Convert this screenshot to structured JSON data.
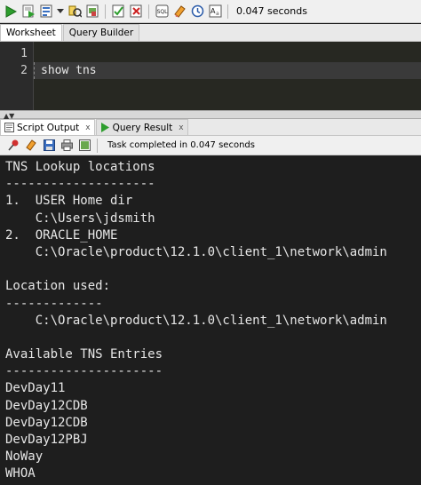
{
  "toolbar": {
    "icons": [
      "run-statement-icon",
      "run-script-icon",
      "autotrace-icon",
      "dropdown-icon",
      "explain-plan-icon",
      "sql-tuning-icon",
      "commit-icon",
      "rollback-icon",
      "unshared-sql-icon",
      "clear-icon",
      "history-icon",
      "format-icon"
    ],
    "elapsed": "0.047 seconds"
  },
  "worksheet_tabs": [
    {
      "label": "Worksheet",
      "active": true
    },
    {
      "label": "Query Builder",
      "active": false
    }
  ],
  "editor": {
    "lines": [
      {
        "number": "1",
        "text": ""
      },
      {
        "number": "2",
        "text": "show tns"
      }
    ]
  },
  "output_tabs": [
    {
      "label": "Script Output",
      "close": "x",
      "active": true
    },
    {
      "label": "Query Result",
      "close": "x",
      "active": false
    }
  ],
  "output_toolbar": {
    "status": "Task completed in 0.047 seconds"
  },
  "output": {
    "lines": [
      "TNS Lookup locations",
      "--------------------",
      "1.  USER Home dir",
      "    C:\\Users\\jdsmith",
      "2.  ORACLE_HOME",
      "    C:\\Oracle\\product\\12.1.0\\client_1\\network\\admin",
      "",
      "Location used:",
      "-------------",
      "    C:\\Oracle\\product\\12.1.0\\client_1\\network\\admin",
      "",
      "Available TNS Entries",
      "---------------------",
      "DevDay11",
      "DevDay12CDB",
      "DevDay12CDB",
      "DevDay12PBJ",
      "NoWay",
      "WHOA"
    ]
  }
}
